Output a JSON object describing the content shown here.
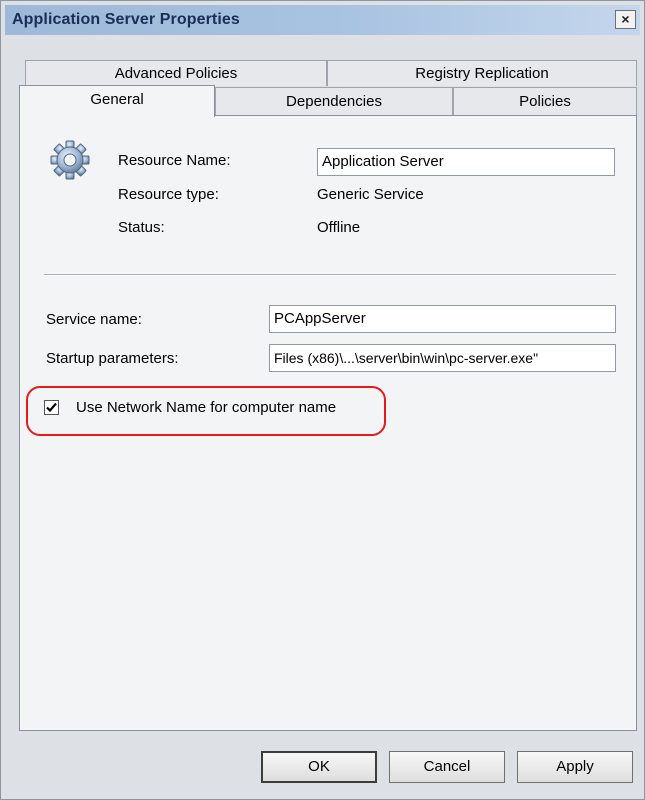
{
  "window": {
    "title": "Application Server Properties",
    "close_glyph": "×"
  },
  "tabs": {
    "row1": [
      "Advanced Policies",
      "Registry Replication"
    ],
    "row2": [
      "General",
      "Dependencies",
      "Policies"
    ],
    "active": "General"
  },
  "general": {
    "icon": "gear-icon",
    "resource_name_label": "Resource Name:",
    "resource_name_value": "Application Server",
    "resource_type_label": "Resource type:",
    "resource_type_value": "Generic Service",
    "status_label": "Status:",
    "status_value": "Offline",
    "service_name_label": "Service name:",
    "service_name_value": "PCAppServer",
    "startup_params_label": "Startup parameters:",
    "startup_params_value": "Files (x86)\\...\\server\\bin\\win\\pc-server.exe\"",
    "use_network_name_label": "Use Network Name for computer name",
    "use_network_name_checked": true
  },
  "buttons": {
    "ok": "OK",
    "cancel": "Cancel",
    "apply": "Apply"
  },
  "colors": {
    "highlight": "#e31b1b",
    "titlebar": "#a9c3e2"
  }
}
